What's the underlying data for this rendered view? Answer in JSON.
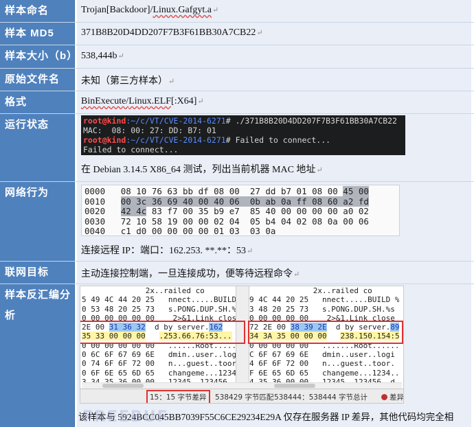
{
  "rows": {
    "name": {
      "label": "样本命名",
      "value_parts": [
        "Trojan[Backdoor]/",
        "Linux.Gafgyt.a"
      ],
      "mark": "↵"
    },
    "md5": {
      "label": "样本 MD5",
      "value": "371B8B20D4DD207F7B3F61BB30A7CB22",
      "mark": "↵"
    },
    "size": {
      "label": "样本大小（b）",
      "value": "538,444b",
      "mark": "↵"
    },
    "filename": {
      "label": "原始文件名",
      "value": "未知（第三方样本）",
      "mark": "↵"
    },
    "format": {
      "label": "格式",
      "value_parts": [
        "BinExecute/",
        "Linux.ELF",
        "[:X64]"
      ],
      "mark": "↵"
    },
    "runtime": {
      "label": "运行状态",
      "terminal": {
        "line1_user": "root@kind",
        "line1_path": ":~/c/VT/CVE-2014-6271",
        "line1_cmd": "# ./371B8B20D4DD207F7B3F61BB30A7CB22",
        "line2": "MAC:  08: 00: 27: DD: B7: 01",
        "line3_user": "root@kind",
        "line3_path": ":~/c/VT/CVE-2014-6271",
        "line3_cmd": "# Failed to connect...",
        "line4": "Failed to connect..."
      },
      "caption": "在 Debian 3.14.5 X86_64 测试，列出当前机器 MAC 地址",
      "mark": "↵"
    },
    "network": {
      "label": "网络行为",
      "hex_rows": [
        {
          "off": "0000",
          "a": "08 10 76 63 bb df 08 00  27 dd b7 01 08 00 ",
          "h": "45 00",
          "b": ""
        },
        {
          "off": "0010",
          "a": "",
          "h": "00 3c 36 69 40 00 40 06  0b ab 0a ff 08 60 a2 fd",
          "b": ""
        },
        {
          "off": "0020",
          "a": "",
          "h": "42 4c",
          "b": " 83 f7 00 35 b9 e7  85 40 00 00 00 00 a0 02"
        },
        {
          "off": "0030",
          "a": "72 10 58 19 00 00 02 04  05 b4 04 02 08 0a 00 06",
          "h": "",
          "b": ""
        },
        {
          "off": "0040",
          "a": "c1 d0 00 00 00 00 01 03  03 0a",
          "h": "",
          "b": ""
        }
      ],
      "caption": "连接远程 IP：端口：162.253. **.**：53",
      "mark": "↵"
    },
    "target": {
      "label": "联网目标",
      "value": "主动连接控制端，一旦连接成功，便等待远程命令",
      "mark": "↵"
    },
    "disasm": {
      "label": "样本反汇编分析",
      "left_lines": [
        "              2x..railed co",
        "5 49 4C 44 20 25   nnect.....BUILD %",
        "0 53 48 20 25 73   s.PONG.DUP.SH.%s",
        "0 00 00 00 00 00    2>&1.Link close",
        "{HL}",
        "{YL}",
        "0 00 00 00 00 00   ......Root.......",
        "0 6C 6F 67 69 6E   dmin..user..logi",
        "0 74 6F 6F 72 00   n...guest..toor.",
        "0 6F 6E 65 6D 65   changeme...1234..",
        "3 34 35 36 00 00   12345..123456..d"
      ],
      "right_lines": [
        "              2x..railed co",
        "9 4C 44 20 25   nnect.....BUILD %",
        "3 48 20 25 73   s.PONG.DUP.SH.%s",
        "0 00 00 00 00    2>&1.Link close",
        "{HL}",
        "{YL}",
        "0 00 00 00 00   .......Root......",
        "C 6F 67 69 6E   dmin..user..logi",
        "4 6F 6F 72 00   n...guest..toor.",
        "F 6E 65 6D 65   changeme...1234..",
        "4 35 36 00 00   12345..123456..d"
      ],
      "left_hl": {
        "pre": "2E 00 ",
        "sel": "31 36 32",
        "mid": "  d by server.",
        "tail": "162"
      },
      "left_yl": {
        "pre": "35 33 00 00 00",
        "mid": "   ",
        "tail": ".253.66.76:53..."
      },
      "right_hl": {
        "pre": "72 2E 00 ",
        "sel": "38 39 2E",
        "mid": "  d by server.",
        "tail": "89."
      },
      "right_yl": {
        "pre": "34 3A 35 00 00 00",
        "mid": "   ",
        "tail": "238.150.154:5..."
      },
      "status": {
        "diff": "15：15 字节差异",
        "match": "538429 字节匹配",
        "total": "538444：538444 字节总计",
        "legend": "差异"
      },
      "caption": "该样本与 5924BCC045BB7039F55C6CE29234E29A 仅存在服务器 IP 差异，其他代码均完全相",
      "watermark": "FREEBUF"
    }
  },
  "colors": {
    "label_bg": "#4f81bd",
    "value_bg": "#e9eef7",
    "highlight_red": "#e03030"
  }
}
